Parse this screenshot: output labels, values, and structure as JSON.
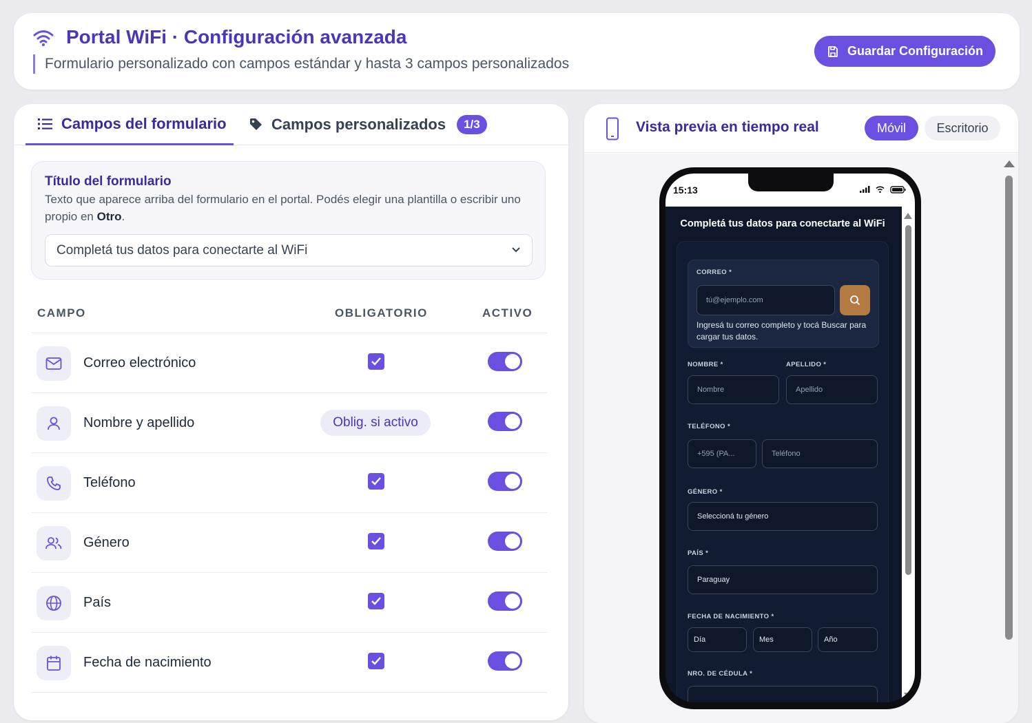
{
  "header": {
    "title": "Portal WiFi · Configuración avanzada",
    "subtitle": "Formulario personalizado con campos estándar y hasta 3 campos personalizados",
    "save_label": "Guardar Configuración"
  },
  "tabs": {
    "fields_label": "Campos del formulario",
    "custom_label": "Campos personalizados",
    "custom_count": "1/3"
  },
  "title_section": {
    "heading": "Título del formulario",
    "description": "Texto que aparece arriba del formulario en el portal. Podés elegir una plantilla o escribir uno propio en ",
    "description_bold": "Otro",
    "description_end": ".",
    "selected": "Completá tus datos para conectarte al WiFi"
  },
  "table": {
    "col_field": "CAMPO",
    "col_required": "OBLIGATORIO",
    "col_active": "ACTIVO",
    "rows": [
      {
        "label": "Correo electrónico",
        "icon": "mail-icon",
        "required": true,
        "active": true
      },
      {
        "label": "Nombre y apellido",
        "icon": "user-icon",
        "required_text": "Oblig. si activo",
        "active": true
      },
      {
        "label": "Teléfono",
        "icon": "phone-icon",
        "required": true,
        "active": true
      },
      {
        "label": "Género",
        "icon": "users-icon",
        "required": true,
        "active": true
      },
      {
        "label": "País",
        "icon": "globe-icon",
        "required": true,
        "active": true
      },
      {
        "label": "Fecha de nacimiento",
        "icon": "calendar-icon",
        "required": true,
        "active": true
      }
    ]
  },
  "preview": {
    "title": "Vista previa en tiempo real",
    "mode_mobile": "Móvil",
    "mode_desktop": "Escritorio",
    "time": "15:13",
    "form_title": "Completá tus datos para conectarte al WiFi",
    "email_label": "CORREO *",
    "email_placeholder": "tú@ejemplo.com",
    "email_hint": "Ingresá tu correo completo y tocá Buscar para cargar tus datos.",
    "name_label": "NOMBRE *",
    "name_placeholder": "Nombre",
    "surname_label": "APELLIDO *",
    "surname_placeholder": "Apellido",
    "phone_label": "TELÉFONO *",
    "phone_code": "+595 (PA...",
    "phone_placeholder": "Teléfono",
    "gender_label": "GÉNERO *",
    "gender_placeholder": "Seleccioná tu género",
    "country_label": "PAÍS *",
    "country_value": "Paraguay",
    "dob_label": "FECHA DE NACIMIENTO *",
    "dob_day": "Día",
    "dob_month": "Mes",
    "dob_year": "Año",
    "id_label": "NRO. DE CÉDULA *"
  },
  "colors": {
    "accent": "#6b4fe0",
    "title": "#4c35b8",
    "preview_bg": "#0f172a",
    "search_button": "#b37a41"
  }
}
